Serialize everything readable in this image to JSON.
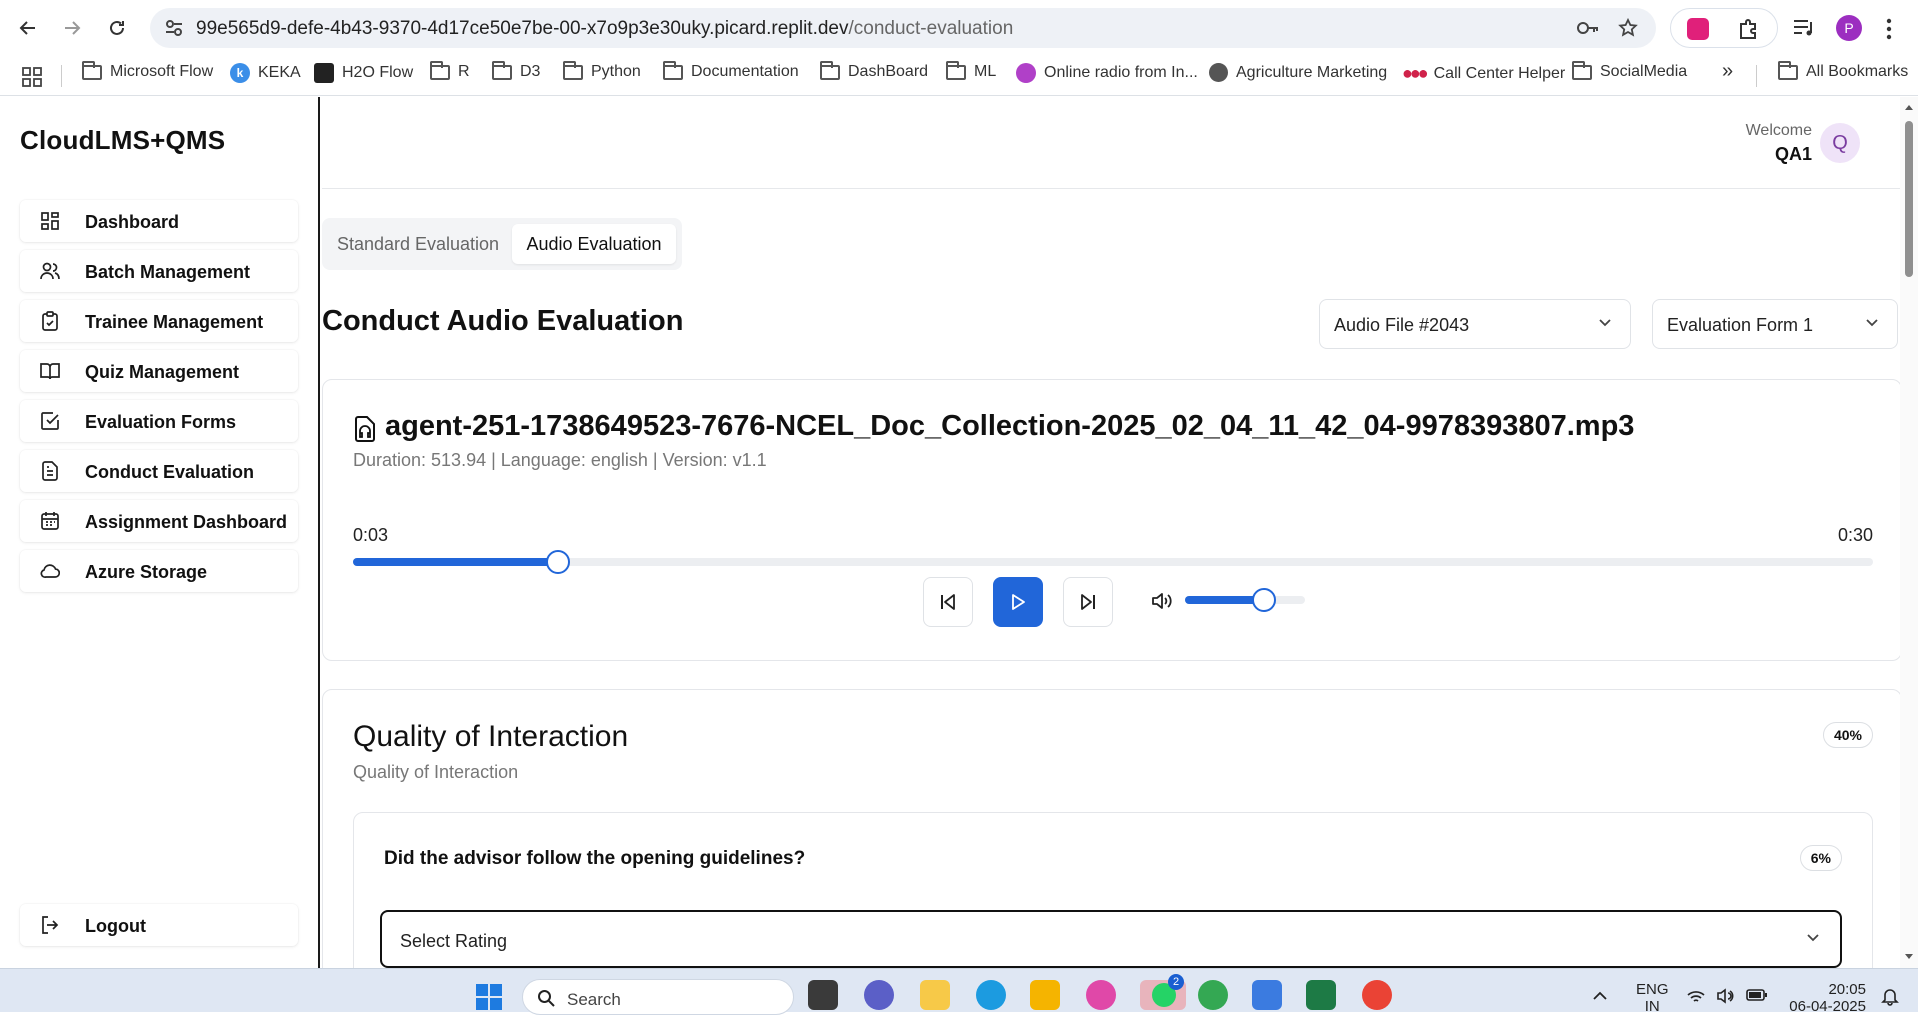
{
  "browser": {
    "url_host": "99e565d9-defe-4b43-9370-4d17ce50e7be-00-x7o9p3e30uky.picard.replit.dev",
    "url_path": "/conduct-evaluation",
    "bookmarks": [
      {
        "label": "Microsoft Flow",
        "icon": "folder-icon"
      },
      {
        "label": "KEKA",
        "icon": "keka-icon"
      },
      {
        "label": "H2O Flow",
        "icon": "h2o-icon"
      },
      {
        "label": "R",
        "icon": "folder-icon"
      },
      {
        "label": "D3",
        "icon": "folder-icon"
      },
      {
        "label": "Python",
        "icon": "folder-icon"
      },
      {
        "label": "Documentation",
        "icon": "folder-icon"
      },
      {
        "label": "DashBoard",
        "icon": "folder-icon"
      },
      {
        "label": "ML",
        "icon": "folder-icon"
      },
      {
        "label": "Online radio from In...",
        "icon": "radio-icon"
      },
      {
        "label": "Agriculture Marketing",
        "icon": "globe-icon"
      },
      {
        "label": "Call Center Helper",
        "icon": "dots-icon"
      },
      {
        "label": "SocialMedia",
        "icon": "folder-icon"
      }
    ],
    "more_label": "»",
    "all_bookmarks": "All Bookmarks",
    "profile_initial": "P"
  },
  "app": {
    "brand": "CloudLMS+QMS",
    "nav": [
      {
        "label": "Dashboard",
        "icon": "grid-icon"
      },
      {
        "label": "Batch Management",
        "icon": "users-icon"
      },
      {
        "label": "Trainee Management",
        "icon": "clipboard-icon"
      },
      {
        "label": "Quiz Management",
        "icon": "book-icon"
      },
      {
        "label": "Evaluation Forms",
        "icon": "check-square-icon"
      },
      {
        "label": "Conduct Evaluation",
        "icon": "file-list-icon"
      },
      {
        "label": "Assignment Dashboard",
        "icon": "calendar-icon"
      },
      {
        "label": "Azure Storage",
        "icon": "cloud-icon"
      }
    ],
    "logout": "Logout"
  },
  "header": {
    "welcome": "Welcome",
    "user": "QA1",
    "avatar": "Q"
  },
  "tabs": {
    "standard": "Standard Evaluation",
    "audio": "Audio Evaluation"
  },
  "page": {
    "title": "Conduct Audio Evaluation",
    "audio_select": "Audio File #2043",
    "form_select": "Evaluation Form 1"
  },
  "player": {
    "file_name": "agent-251-1738649523-7676-NCEL_Doc_Collection-2025_02_04_11_42_04-9978393807.mp3",
    "meta": "Duration: 513.94 | Language: english | Version: v1.1",
    "current_time": "0:03",
    "total_time": "0:30",
    "progress": 0.135,
    "volume": 0.66
  },
  "section": {
    "title": "Quality of Interaction",
    "subtitle": "Quality of Interaction",
    "weight": "40%",
    "question": "Did the advisor follow the opening guidelines?",
    "question_weight": "6%",
    "rating_placeholder": "Select Rating"
  },
  "taskbar": {
    "search": "Search",
    "lang1": "ENG",
    "lang2": "IN",
    "time": "20:05",
    "date": "06-04-2025",
    "whatsapp_badge": "2"
  }
}
